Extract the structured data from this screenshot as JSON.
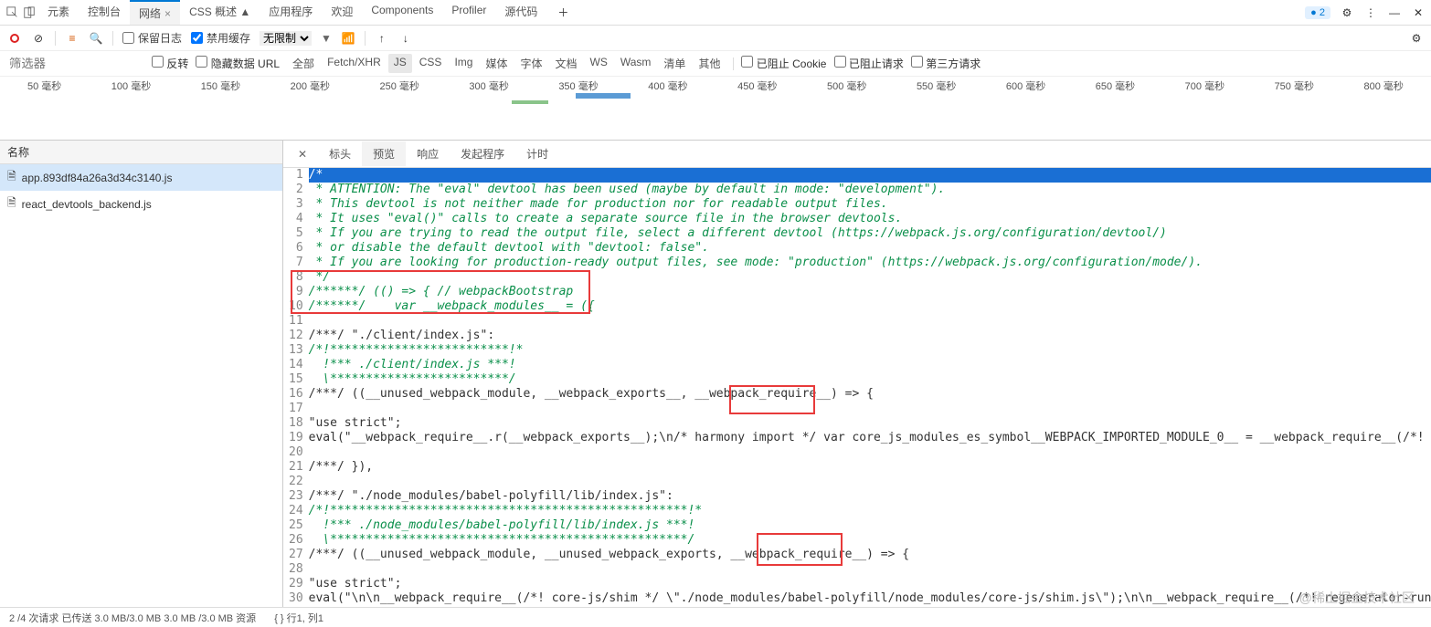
{
  "topTabs": [
    "元素",
    "控制台",
    "网络",
    "CSS 概述 ▲",
    "应用程序",
    "欢迎",
    "Components",
    "Profiler",
    "源代码"
  ],
  "topActive": 2,
  "issuesBadge": "2",
  "toolbar": {
    "preserveLog": "保留日志",
    "disableCache": "禁用缓存",
    "throttle": "无限制"
  },
  "filter": {
    "placeholder": "筛选器",
    "invert": "反转",
    "hideDataUrls": "隐藏数据 URL",
    "types": [
      "全部",
      "Fetch/XHR",
      "JS",
      "CSS",
      "Img",
      "媒体",
      "字体",
      "文档",
      "WS",
      "Wasm",
      "清单",
      "其他"
    ],
    "typeActive": 2,
    "blockedCookies": "已阻止 Cookie",
    "blockedRequests": "已阻止请求",
    "thirdParty": "第三方请求"
  },
  "timelineTicks": [
    "50 毫秒",
    "100 毫秒",
    "150 毫秒",
    "200 毫秒",
    "250 毫秒",
    "300 毫秒",
    "350 毫秒",
    "400 毫秒",
    "450 毫秒",
    "500 毫秒",
    "550 毫秒",
    "600 毫秒",
    "650 毫秒",
    "700 毫秒",
    "750 毫秒",
    "800 毫秒"
  ],
  "nameHeader": "名称",
  "files": [
    "app.893df84a26a3d34c3140.js",
    "react_devtools_backend.js"
  ],
  "fileSelected": 0,
  "detailTabs": [
    "标头",
    "预览",
    "响应",
    "发起程序",
    "计时"
  ],
  "detailActive": 1,
  "codeLines": [
    {
      "n": 1,
      "cls": "l1",
      "t": "/*"
    },
    {
      "n": 2,
      "cls": "comment",
      "t": " * ATTENTION: The \"eval\" devtool has been used (maybe by default in mode: \"development\")."
    },
    {
      "n": 3,
      "cls": "comment",
      "t": " * This devtool is not neither made for production nor for readable output files."
    },
    {
      "n": 4,
      "cls": "comment",
      "t": " * It uses \"eval()\" calls to create a separate source file in the browser devtools."
    },
    {
      "n": 5,
      "cls": "comment",
      "t": " * If you are trying to read the output file, select a different devtool (https://webpack.js.org/configuration/devtool/)"
    },
    {
      "n": 6,
      "cls": "comment",
      "t": " * or disable the default devtool with \"devtool: false\"."
    },
    {
      "n": 7,
      "cls": "comment",
      "t": " * If you are looking for production-ready output files, see mode: \"production\" (https://webpack.js.org/configuration/mode/)."
    },
    {
      "n": 8,
      "cls": "comment",
      "t": " */"
    },
    {
      "n": 9,
      "cls": "comment",
      "t": "/******/ (() => { // webpackBootstrap"
    },
    {
      "n": 10,
      "cls": "comment",
      "t": "/******/    var __webpack_modules__ = ({"
    },
    {
      "n": 11,
      "cls": "code-line",
      "t": ""
    },
    {
      "n": 12,
      "cls": "code-line",
      "t": "/***/ \"./client/index.js\":"
    },
    {
      "n": 13,
      "cls": "comment",
      "t": "/*!*************************!*"
    },
    {
      "n": 14,
      "cls": "comment",
      "t": "  !*** ./client/index.js ***!"
    },
    {
      "n": 15,
      "cls": "comment",
      "t": "  \\*************************/"
    },
    {
      "n": 16,
      "cls": "code-line",
      "t": "/***/ ((__unused_webpack_module, __webpack_exports__, __webpack_require__) => {"
    },
    {
      "n": 17,
      "cls": "code-line",
      "t": ""
    },
    {
      "n": 18,
      "cls": "code-line",
      "t": "\"use strict\";"
    },
    {
      "n": 19,
      "cls": "code-line",
      "t": "eval(\"__webpack_require__.r(__webpack_exports__);\\n/* harmony import */ var core_js_modules_es_symbol__WEBPACK_IMPORTED_MODULE_0__ = __webpack_require__(/*! core-js/modules/es.symbo"
    },
    {
      "n": 20,
      "cls": "code-line",
      "t": ""
    },
    {
      "n": 21,
      "cls": "code-line",
      "t": "/***/ }),"
    },
    {
      "n": 22,
      "cls": "code-line",
      "t": ""
    },
    {
      "n": 23,
      "cls": "code-line",
      "t": "/***/ \"./node_modules/babel-polyfill/lib/index.js\":"
    },
    {
      "n": 24,
      "cls": "comment",
      "t": "/*!**************************************************!*"
    },
    {
      "n": 25,
      "cls": "comment",
      "t": "  !*** ./node_modules/babel-polyfill/lib/index.js ***!"
    },
    {
      "n": 26,
      "cls": "comment",
      "t": "  \\**************************************************/"
    },
    {
      "n": 27,
      "cls": "code-line",
      "t": "/***/ ((__unused_webpack_module, __unused_webpack_exports, __webpack_require__) => {"
    },
    {
      "n": 28,
      "cls": "code-line",
      "t": ""
    },
    {
      "n": 29,
      "cls": "code-line",
      "t": "\"use strict\";"
    },
    {
      "n": 30,
      "cls": "code-line",
      "t": "eval(\"\\n\\n__webpack_require__(/*! core-js/shim */ \\\"./node_modules/babel-polyfill/node_modules/core-js/shim.js\\\");\\n\\n__webpack_require__(/*! regenerator-runtime/runtime */ \\\"./node"
    },
    {
      "n": 31,
      "cls": "code-line",
      "t": ""
    }
  ],
  "status": {
    "requests": "2 /4 次请求  已传送 3.0 MB/3.0 MB  3.0 MB /3.0 MB 资源",
    "cursor": "{ }  行1, 列1"
  },
  "watermark": "@稀土掘金技术社区"
}
